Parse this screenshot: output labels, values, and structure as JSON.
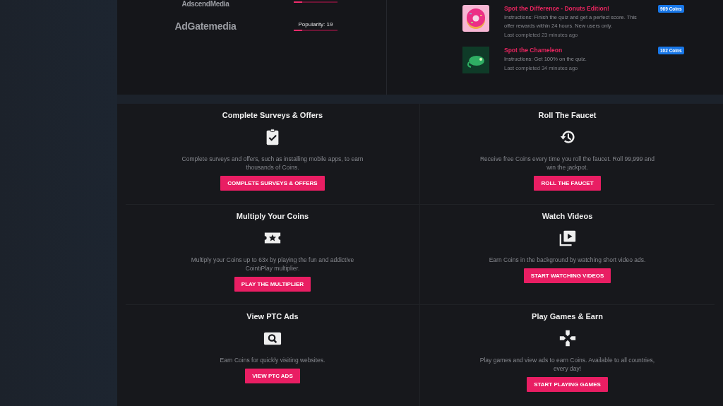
{
  "partners": [
    {
      "logo": "AdscendMedia",
      "popularity": {
        "level": 0.2
      }
    },
    {
      "logo": "AdGatemedia",
      "popularity": {
        "label": "Popularity: 19",
        "level": 0.19
      }
    }
  ],
  "offers": [
    {
      "kind": "donut",
      "title": "Spot the Difference - Donuts Edition!",
      "instructions": "Instructions: Finish the quiz and get a perfect score. This offer rewards within 24 hours. New users only.",
      "last_completed": "Last completed 23 minutes ago",
      "reward": "969 Coins"
    },
    {
      "kind": "chameleon",
      "title": "Spot the Chameleon",
      "instructions": "Instructions: Get 100% on the quiz.",
      "last_completed": "Last completed 34 minutes ago",
      "reward": "102 Coins"
    }
  ],
  "earn_options": [
    {
      "kind": "clipboard",
      "title": "Complete Surveys & Offers",
      "description": "Complete surveys and offers, such as installing mobile apps, to earn thousands of Coins.",
      "button": "COMPLETE SURVEYS & OFFERS"
    },
    {
      "kind": "history",
      "title": "Roll The Faucet",
      "description": "Receive free Coins every time you roll the faucet. Roll 99,999 and win the jackpot.",
      "button": "ROLL THE FAUCET"
    },
    {
      "kind": "ticket",
      "title": "Multiply Your Coins",
      "description": "Multiply your Coins up to 63x by playing the fun and addictive CointiPlay multiplier.",
      "button": "PLAY THE MULTIPLIER"
    },
    {
      "kind": "video",
      "title": "Watch Videos",
      "description": "Earn Coins in the background by watching short video ads.",
      "button": "START WATCHING VIDEOS"
    },
    {
      "kind": "search",
      "title": "View PTC Ads",
      "description": "Earn Coins for quickly visiting websites.",
      "button": "VIEW PTC ADS"
    },
    {
      "kind": "gamepad",
      "title": "Play Games & Earn",
      "description": "Play games and view ads to earn Coins. Available to all countries, every day!",
      "button": "START PLAYING GAMES"
    }
  ]
}
